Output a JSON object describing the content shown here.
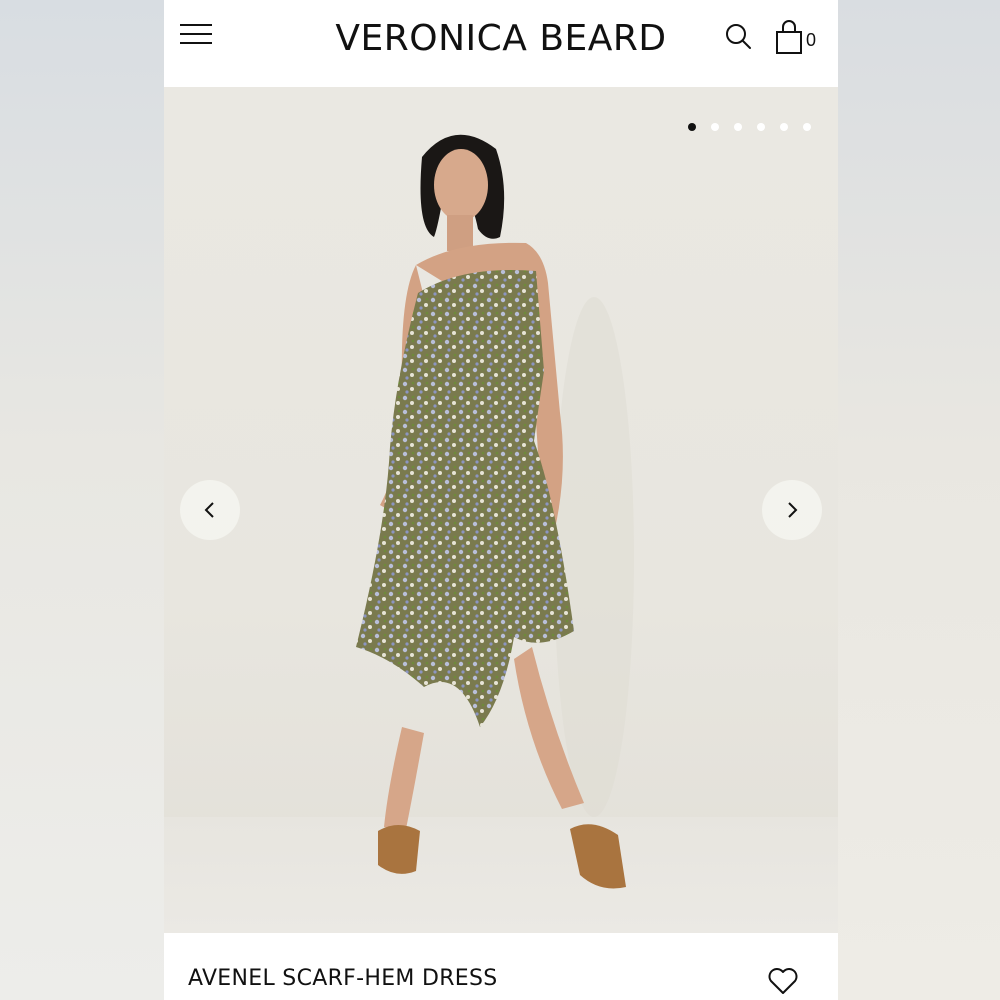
{
  "header": {
    "brand": "VERONICA BEARD",
    "cart_count": "0",
    "icons": {
      "menu": "hamburger-menu-icon",
      "search": "search-icon",
      "cart": "shopping-bag-icon"
    }
  },
  "gallery": {
    "image": "model-wearing-floral-dress-photo",
    "current_slide": 1,
    "slide_count": 6,
    "icons": {
      "previous": "chevron-left-icon",
      "next": "chevron-right-icon"
    }
  },
  "product": {
    "name": "AVENEL SCARF-HEM DRESS",
    "wishlist_icon": "heart-icon"
  },
  "colors": {
    "text": "#111111",
    "background": "#ffffff",
    "photo_backdrop": "#e9e7e1"
  }
}
